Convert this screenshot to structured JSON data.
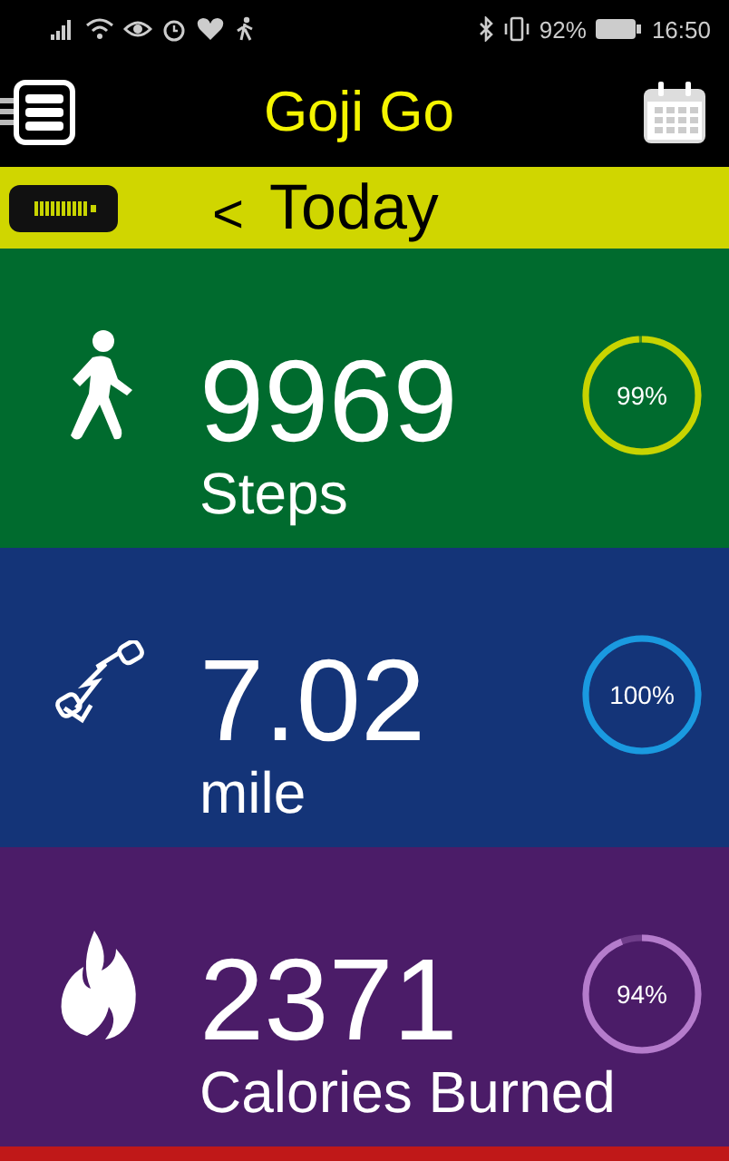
{
  "status_bar": {
    "battery_text": "92%",
    "time": "16:50"
  },
  "app_bar": {
    "title": "Goji Go"
  },
  "day_bar": {
    "back": "<",
    "label": "Today"
  },
  "panels": [
    {
      "kind": "steps",
      "color": "#006b2e",
      "value": "9969",
      "unit": "Steps",
      "ring": {
        "color": "#c8d400",
        "level": 0.99,
        "percent": "99%"
      }
    },
    {
      "kind": "distance",
      "color": "#143478",
      "value": "7.02",
      "unit": "mile",
      "ring": {
        "color": "#1a9ae0",
        "level": 1,
        "percent": "100%"
      }
    },
    {
      "kind": "calories",
      "color": "#4b1c68",
      "value": "2371",
      "unit": "Calories Burned",
      "ring": {
        "color": "#b57ccc",
        "level": 0.94,
        "percent": "94%"
      }
    }
  ],
  "bottom_strip": {
    "color": "#c01818"
  }
}
